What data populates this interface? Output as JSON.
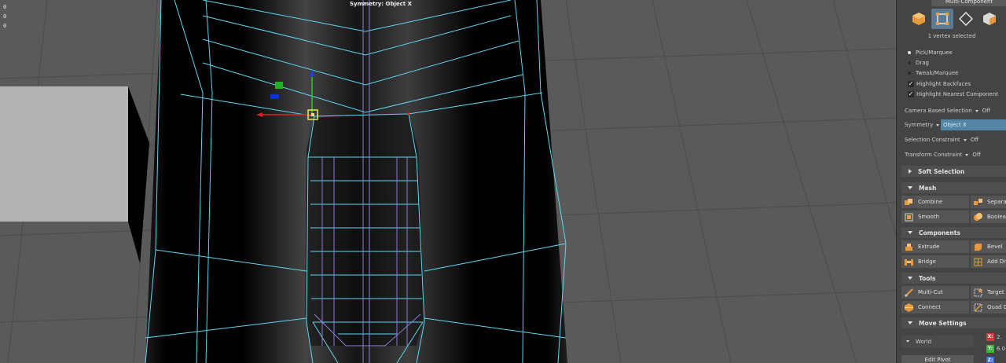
{
  "viewport": {
    "hud_stats": [
      "0",
      "0",
      "0"
    ],
    "symmetry_label": "Symmetry: Object X"
  },
  "panel": {
    "mode_header": "Multi-Component",
    "mode_buttons": [
      {
        "name": "object-mode-icon",
        "active": false
      },
      {
        "name": "multi-component-icon",
        "active": true
      },
      {
        "name": "vertex-mode-icon",
        "active": false
      },
      {
        "name": "face-mode-icon",
        "active": false
      }
    ],
    "selection_count": "1 vertex selected",
    "pick_options": [
      {
        "label": "Pick/Marquee",
        "selected": true
      },
      {
        "label": "Drag",
        "selected": false
      },
      {
        "label": "Tweak/Marquee",
        "selected": false
      }
    ],
    "checkboxes": [
      {
        "label": "Highlight Backfaces",
        "checked": true
      },
      {
        "label": "Highlight Nearest Component",
        "checked": true
      }
    ],
    "settings": {
      "camera_based_selection": {
        "label": "Camera Based Selection",
        "value": "Off"
      },
      "symmetry": {
        "label": "Symmetry",
        "value": "Object X"
      },
      "selection_constraint": {
        "label": "Selection Constraint",
        "value": "Off"
      },
      "transform_constraint": {
        "label": "Transform Constraint",
        "value": "Off"
      }
    },
    "soft_selection": "Soft Selection",
    "sections": {
      "mesh": {
        "title": "Mesh",
        "tools": [
          {
            "label": "Combine",
            "icon": "combine-icon"
          },
          {
            "label": "Separate",
            "icon": "separate-icon"
          },
          {
            "label": "Smooth",
            "icon": "smooth-icon"
          },
          {
            "label": "Boolean",
            "icon": "boolean-icon"
          }
        ]
      },
      "components": {
        "title": "Components",
        "tools": [
          {
            "label": "Extrude",
            "icon": "extrude-icon"
          },
          {
            "label": "Bevel",
            "icon": "bevel-icon"
          },
          {
            "label": "Bridge",
            "icon": "bridge-icon"
          },
          {
            "label": "Add Divisions",
            "icon": "add-divisions-icon"
          }
        ]
      },
      "tools": {
        "title": "Tools",
        "tools": [
          {
            "label": "Multi-Cut",
            "icon": "multi-cut-icon"
          },
          {
            "label": "Target Weld",
            "icon": "target-weld-icon"
          },
          {
            "label": "Connect",
            "icon": "connect-icon"
          },
          {
            "label": "Quad Draw",
            "icon": "quad-draw-icon"
          }
        ]
      },
      "move_settings": {
        "title": "Move Settings",
        "space": "World",
        "axes": [
          {
            "axis": "X:",
            "value": "2.",
            "color": "#d23b3b"
          },
          {
            "axis": "Y:",
            "value": "6.0",
            "color": "#3fb23f"
          },
          {
            "axis": "Z:",
            "value": "",
            "color": "#3d6fd6"
          }
        ],
        "edit_pivot": "Edit Pivot"
      }
    }
  },
  "colors": {
    "wire": "#5fd8f0",
    "wire_inner": "#8f7cd6",
    "accent_blue": "#5b7a94",
    "field_blue": "#5285a6"
  }
}
